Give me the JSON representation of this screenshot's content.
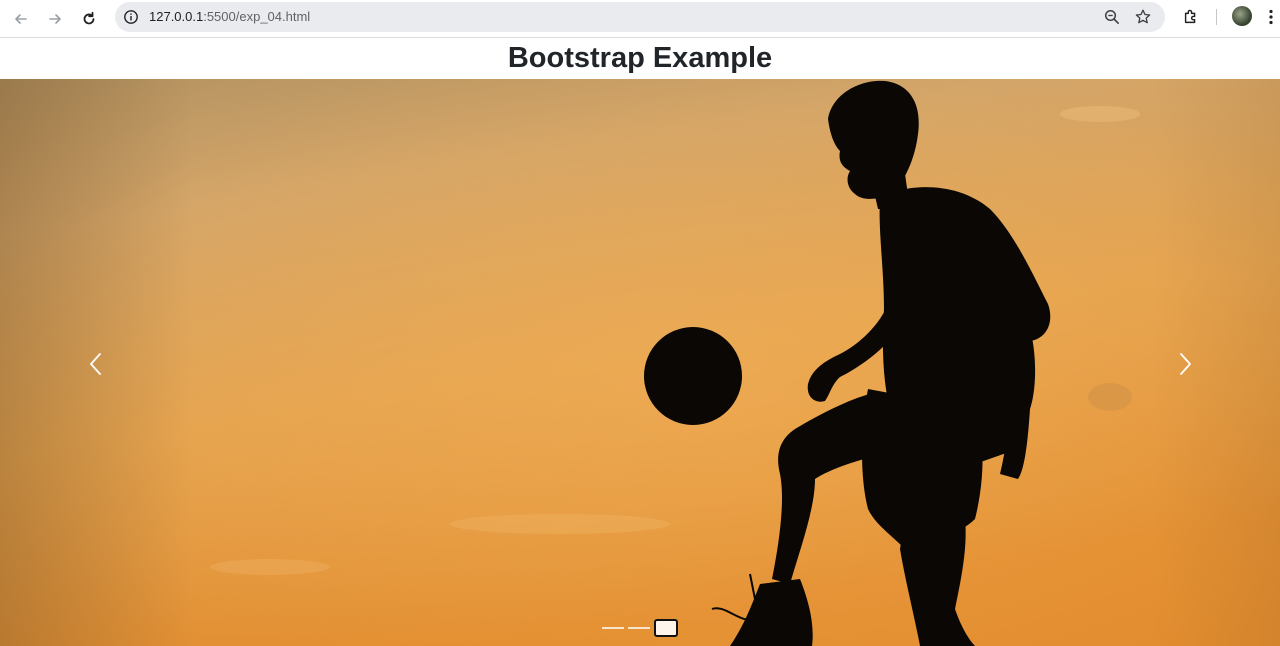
{
  "browser": {
    "url_host": "127.0.0.1",
    "url_path": ":5500/exp_04.html",
    "icons": [
      "back-arrow-icon",
      "forward-arrow-icon",
      "reload-icon",
      "site-info-icon",
      "zoom-icon",
      "bookmark-star-icon",
      "extensions-puzzle-icon",
      "profile-avatar",
      "menu-kebab-icon"
    ]
  },
  "page": {
    "heading": "Bootstrap Example"
  },
  "carousel": {
    "slide_count": 3,
    "active_index": 2,
    "controls": [
      "prev-chevron-icon",
      "next-chevron-icon"
    ],
    "image_description_colors": {
      "sky_top": "#c9a571",
      "sky_mid": "#e3a24f",
      "sky_bottom": "#e08a2c",
      "silhouette": "#0a0705"
    }
  }
}
